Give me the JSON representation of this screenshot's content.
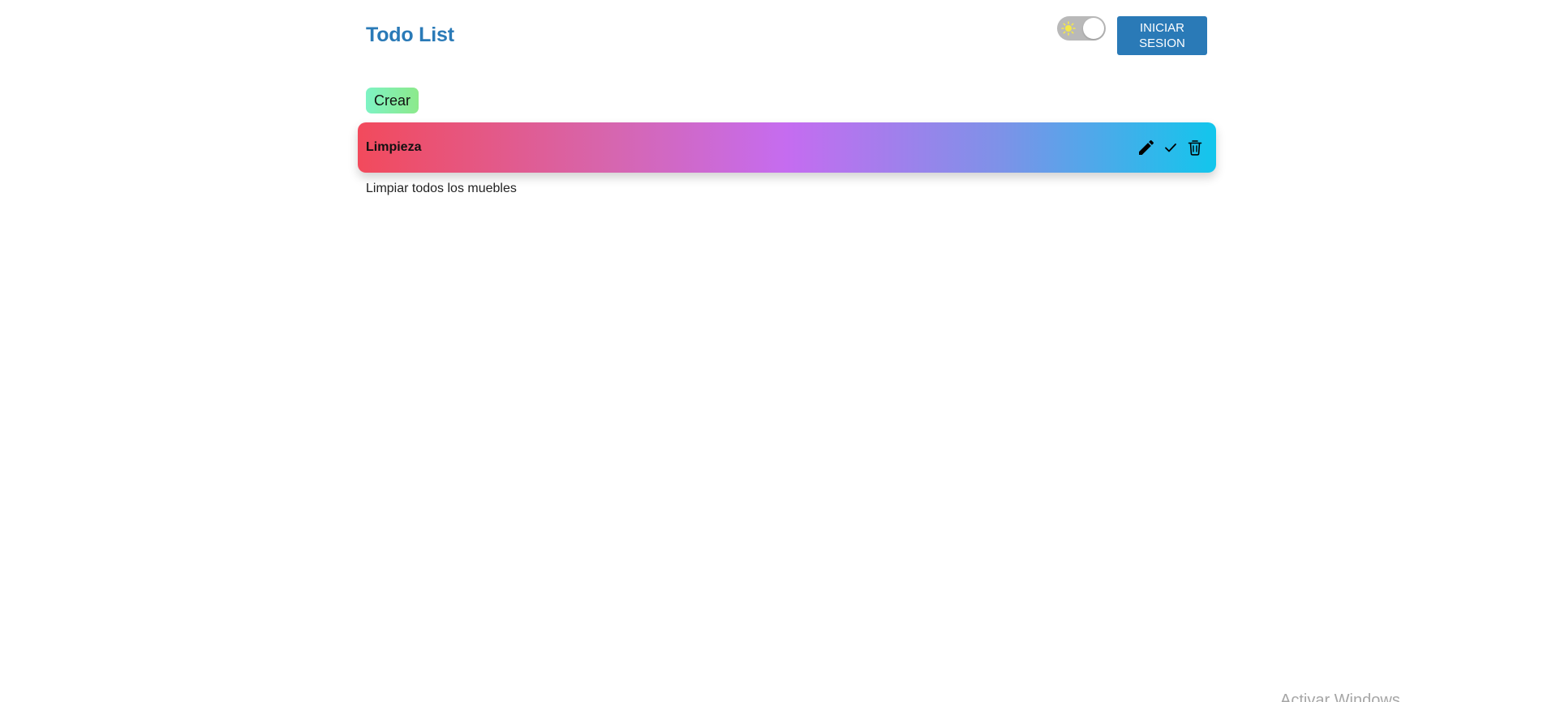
{
  "header": {
    "title": "Todo List",
    "theme_toggle": {
      "icon": "sun-icon",
      "state": "light"
    },
    "login_label": "INICIAR SESION"
  },
  "toolbar": {
    "create_label": "Crear"
  },
  "tasks": [
    {
      "title": "Limpieza",
      "description": "Limpiar todos los muebles",
      "actions": [
        "pencil-icon",
        "check-icon",
        "trash-icon"
      ]
    }
  ],
  "watermark": "Activar Windows",
  "colors": {
    "accent": "#2a7ab7",
    "create_gradient": [
      "#7ef3c4",
      "#8ce98b"
    ],
    "card_gradient": [
      "#f24a5c",
      "#c56cf0",
      "#12c6ec"
    ]
  }
}
